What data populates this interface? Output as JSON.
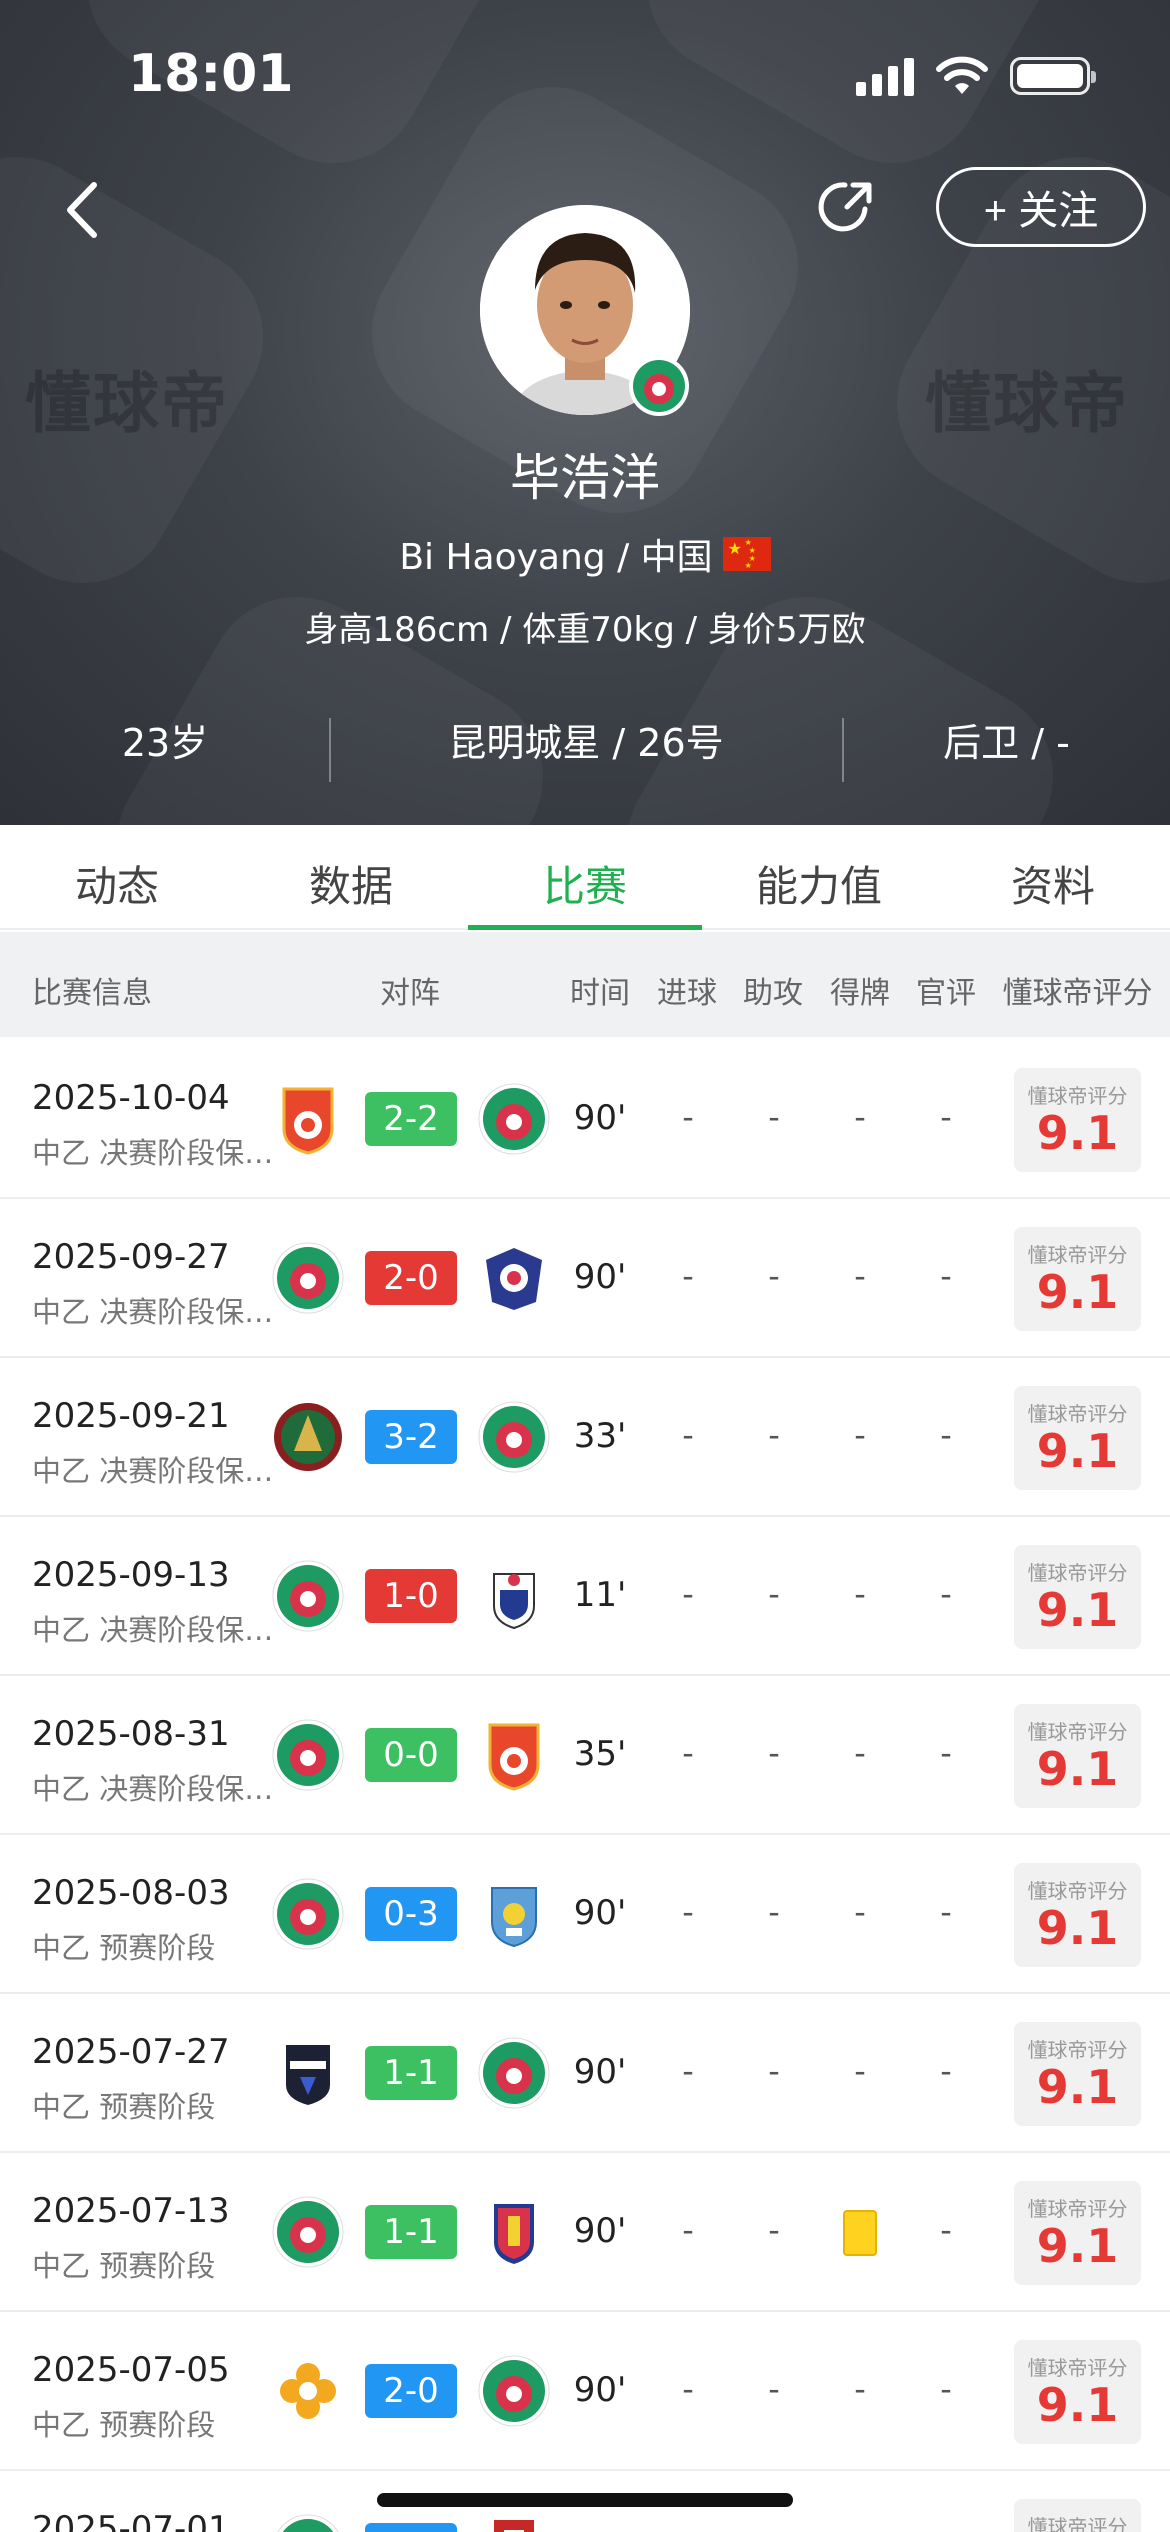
{
  "status_bar": {
    "time": "18:01"
  },
  "header": {
    "follow_label": "+ 关注",
    "watermark": "懂球帝",
    "name": "毕浩洋",
    "en_name_nationality": "Bi Haoyang / 中国",
    "body_info": "身高186cm / 体重70kg / 身价5万欧",
    "age": "23岁",
    "club_number": "昆明城星 / 26号",
    "position": "后卫 / -"
  },
  "tabs": [
    "动态",
    "数据",
    "比赛",
    "能力值",
    "资料"
  ],
  "active_tab": "比赛",
  "table_headers": {
    "info": "比赛信息",
    "matchup": "对阵",
    "time": "时间",
    "goals": "进球",
    "assists": "助攻",
    "cards": "得牌",
    "official": "官评",
    "dqd_rating": "懂球帝评分"
  },
  "rating_label": "懂球帝评分",
  "colors": {
    "green": "#3cc061",
    "red": "#e53935",
    "blue": "#2196f3",
    "accent": "#1fb04f"
  },
  "matches": [
    {
      "date": "2025-10-04",
      "competition": "中乙 决赛阶段保级组",
      "home": "shanxi-badge",
      "away": "kunming-city-badge",
      "score": "2-2",
      "result_color": "green",
      "minutes": "90'",
      "goals": "-",
      "assists": "-",
      "cards": "-",
      "official": "-",
      "rating": "9.1"
    },
    {
      "date": "2025-09-27",
      "competition": "中乙 决赛阶段保级组",
      "home": "kunming-city-badge",
      "away": "blue-club-badge",
      "score": "2-0",
      "result_color": "red",
      "minutes": "90'",
      "goals": "-",
      "assists": "-",
      "cards": "-",
      "official": "-",
      "rating": "9.1"
    },
    {
      "date": "2025-09-21",
      "competition": "中乙 决赛阶段保级组",
      "home": "green-tree-badge",
      "away": "kunming-city-badge",
      "score": "3-2",
      "result_color": "blue",
      "minutes": "33'",
      "goals": "-",
      "assists": "-",
      "cards": "-",
      "official": "-",
      "rating": "9.1"
    },
    {
      "date": "2025-09-13",
      "competition": "中乙 决赛阶段保级组",
      "home": "kunming-city-badge",
      "away": "shield-club-badge",
      "score": "1-0",
      "result_color": "red",
      "minutes": "11'",
      "goals": "-",
      "assists": "-",
      "cards": "-",
      "official": "-",
      "rating": "9.1"
    },
    {
      "date": "2025-08-31",
      "competition": "中乙 决赛阶段保级组",
      "home": "kunming-city-badge",
      "away": "shanxi-badge",
      "score": "0-0",
      "result_color": "green",
      "minutes": "35'",
      "goals": "-",
      "assists": "-",
      "cards": "-",
      "official": "-",
      "rating": "9.1"
    },
    {
      "date": "2025-08-03",
      "competition": "中乙 预赛阶段",
      "home": "kunming-city-badge",
      "away": "blue-shield-badge",
      "score": "0-3",
      "result_color": "blue",
      "minutes": "90'",
      "goals": "-",
      "assists": "-",
      "cards": "-",
      "official": "-",
      "rating": "9.1"
    },
    {
      "date": "2025-07-27",
      "competition": "中乙 预赛阶段",
      "home": "mingtu-badge",
      "away": "kunming-city-badge",
      "score": "1-1",
      "result_color": "green",
      "minutes": "90'",
      "goals": "-",
      "assists": "-",
      "cards": "-",
      "official": "-",
      "rating": "9.1"
    },
    {
      "date": "2025-07-13",
      "competition": "中乙 预赛阶段",
      "home": "kunming-city-badge",
      "away": "red-blue-shield-badge",
      "score": "1-1",
      "result_color": "green",
      "minutes": "90'",
      "goals": "-",
      "assists": "-",
      "cards": "yellow",
      "official": "-",
      "rating": "9.1"
    },
    {
      "date": "2025-07-05",
      "competition": "中乙 预赛阶段",
      "home": "yellow-flower-badge",
      "away": "kunming-city-badge",
      "score": "2-0",
      "result_color": "blue",
      "minutes": "90'",
      "goals": "-",
      "assists": "-",
      "cards": "-",
      "official": "-",
      "rating": "9.1"
    },
    {
      "date": "2025-07-01",
      "competition": "",
      "home": "kunming-city-badge",
      "away": "red-block-badge",
      "score": "",
      "result_color": "blue",
      "minutes": "",
      "goals": "",
      "assists": "",
      "cards": "",
      "official": "",
      "rating": ""
    }
  ]
}
